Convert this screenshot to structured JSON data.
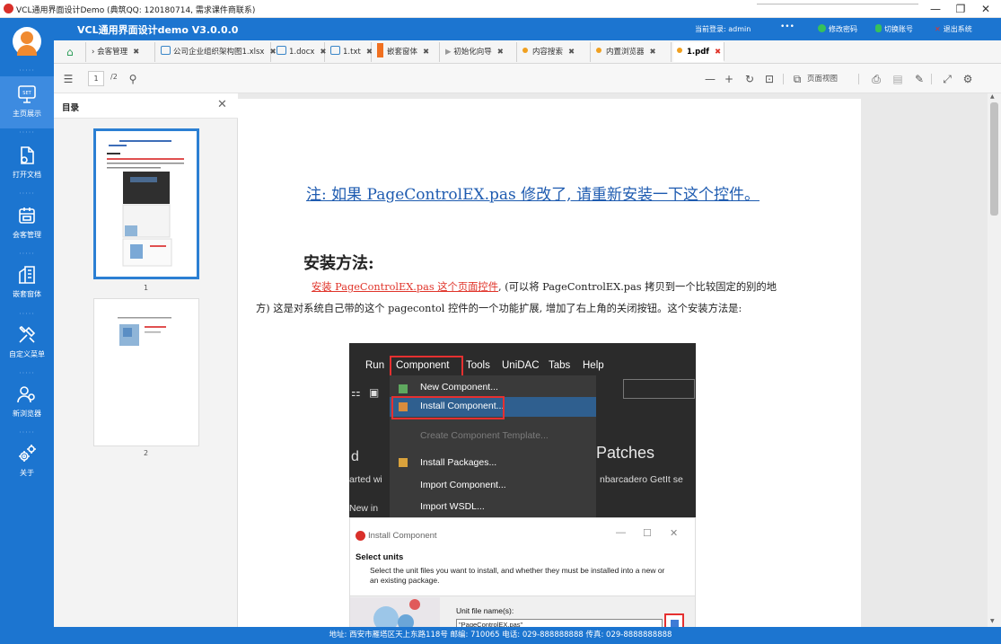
{
  "os_window": {
    "title": "VCL通用界面设计Demo (典筑QQ: 120180714, 需求课件商联系)",
    "controls": [
      "—",
      "❐",
      "✕"
    ]
  },
  "header": {
    "app_title": "VCL通用界面设计demo V3.0.0.0",
    "current_login": "当前登录: admin",
    "more": "•••",
    "change_password": "修改密码",
    "switch_account": "切换账号",
    "logout": "退出系统",
    "colors": {
      "brand": "#1c75d0",
      "green": "#37c15a",
      "red": "#e0342a"
    }
  },
  "sidebar": {
    "items": [
      {
        "label": "主页展示",
        "icon": "monitor-icon"
      },
      {
        "label": "打开文档",
        "icon": "document-icon"
      },
      {
        "label": "会客管理",
        "icon": "calendar-icon"
      },
      {
        "label": "嵌套窗体",
        "icon": "building-icon"
      },
      {
        "label": "自定义菜单",
        "icon": "tools-icon"
      },
      {
        "label": "新浏览器",
        "icon": "users-icon"
      },
      {
        "label": "关于",
        "icon": "gears-icon"
      }
    ],
    "separator": "·····"
  },
  "tabs": [
    {
      "label": "",
      "icon": "home-icon"
    },
    {
      "label": "会客管理",
      "icon": "chevron-icon"
    },
    {
      "label": "公司企业组织架构图1.xlsx",
      "icon": "file-icon"
    },
    {
      "label": "1.docx",
      "icon": "file-icon"
    },
    {
      "label": "1.txt",
      "icon": "file-icon"
    },
    {
      "label": "嵌套窗体",
      "icon": "orange-bar-icon"
    },
    {
      "label": "初始化向导",
      "icon": "play-icon"
    },
    {
      "label": "内容搜索",
      "icon": "orange-dot-icon"
    },
    {
      "label": "内置浏览器",
      "icon": "orange-dot-icon"
    },
    {
      "label": "1.pdf",
      "icon": "orange-dot-icon",
      "active": true
    }
  ],
  "pdf_toolbar": {
    "page_input": "1",
    "page_count": "/2",
    "zoom_out": "—",
    "zoom_in": "+",
    "page_view": "页面视图"
  },
  "toc": {
    "title": "目录",
    "close": "✕",
    "pages": [
      "1",
      "2"
    ]
  },
  "doc": {
    "note": "注: 如果 PageControlEX.pas 修改了, 请重新安装一下这个控件。",
    "heading": "安装方法:",
    "para_link": "安装 PageControlEX.pas 这个页面控件",
    "para_rest": ", (可以将 PageControlEX.pas 拷贝到一个比较固定的别的地方) 这是对系统自己带的这个 pagecontol 控件的一个功能扩展, 增加了右上角的关闭按钮。这个安装方法是:",
    "ide_menu": [
      "Run",
      "Component",
      "Tools",
      "UniDAC",
      "Tabs",
      "Help"
    ],
    "dropdown": [
      "New Component...",
      "Install Component...",
      "Create Component Template...",
      "Install Packages...",
      "Import Component...",
      "Import WSDL..."
    ],
    "patches": "Patches",
    "embarcadero": "nbarcadero GetIt se",
    "started": "arted wi",
    "newin": "New in",
    "dialog_title": "Install Component",
    "dialog_heading": "Select units",
    "dialog_desc": "Select the unit files you want to install, and whether they must be installed into a new or an existing package.",
    "unit_label": "Unit file name(s):",
    "unit_value": "\"PageControlEX.pas\""
  },
  "footer": {
    "text": "地址: 西安市雁塔区天上东路118号  邮编: 710065  电话: 029-888888888  传真: 029-8888888888"
  }
}
